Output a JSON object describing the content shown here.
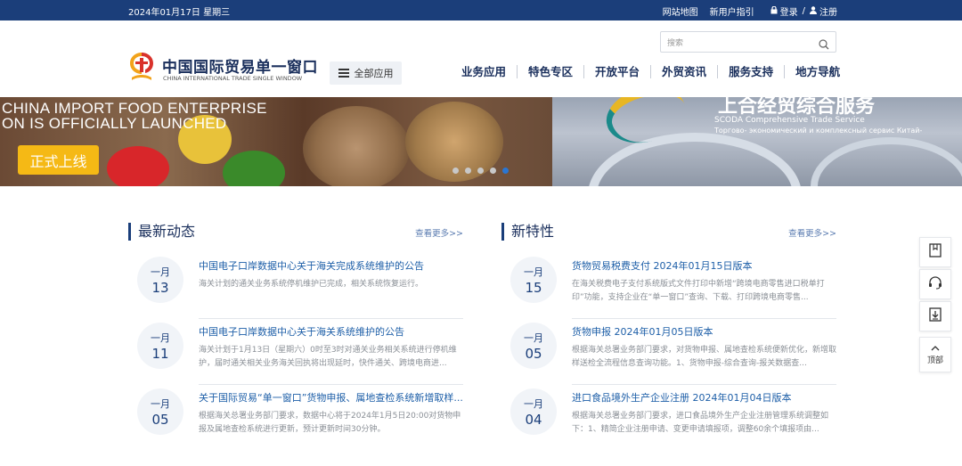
{
  "topbar": {
    "date": "2024年01月17日 星期三",
    "sitemap": "网站地图",
    "new_user_guide": "新用户指引",
    "login": "登录",
    "separator": "/",
    "register": "注册"
  },
  "header": {
    "logo_cn": "中国国际贸易单一窗口",
    "logo_en": "CHINA INTERNATIONAL TRADE SINGLE WINDOW",
    "all_apps": "全部应用",
    "search_placeholder": "搜索",
    "nav": [
      "业务应用",
      "特色专区",
      "开放平台",
      "外贸资讯",
      "服务支持",
      "地方导航"
    ]
  },
  "banner": {
    "left_line1": "CHINA IMPORT FOOD ENTERPRISE",
    "left_line2": "ON IS OFFICIALLY LAUNCHED",
    "launch_button": "正式上线",
    "right_cn": "上合经贸综合服务",
    "right_en1": "SCODA Comprehensive Trade Service",
    "right_en2": "Торгово- экономический и комплексный сервис Китай-",
    "active_slide": 5,
    "slide_count": 5
  },
  "news": {
    "title": "最新动态",
    "more": "查看更多>>",
    "items": [
      {
        "month": "一月",
        "day": "13",
        "title": "中国电子口岸数据中心关于海关完成系统维护的公告",
        "desc": "海关计划的通关业务系统停机维护已完成，相关系统恢复运行。"
      },
      {
        "month": "一月",
        "day": "11",
        "title": "中国电子口岸数据中心关于海关系统维护的公告",
        "desc": "海关计划于1月13日（星期六）0时至3时对通关业务相关系统进行停机维护，届时通关相关业务海关回执将出现延时，快件通关、跨境电商进..."
      },
      {
        "month": "一月",
        "day": "05",
        "title": "关于国际贸易“单一窗口”货物申报、属地查检系统新增取样...",
        "desc": "根据海关总署业务部门要求，数据中心将于2024年1月5日20:00对货物申报及属地查检系统进行更新，预计更新时间30分钟。"
      }
    ]
  },
  "features": {
    "title": "新特性",
    "more": "查看更多>>",
    "items": [
      {
        "month": "一月",
        "day": "15",
        "title": "货物贸易税费支付 2024年01月15日版本",
        "desc": "在海关税费电子支付系统版式文件打印中新增“跨境电商零售进口税单打印”功能，支持企业在“单一窗口”查询、下载、打印跨境电商零售..."
      },
      {
        "month": "一月",
        "day": "05",
        "title": "货物申报 2024年01月05日版本",
        "desc": "根据海关总署业务部门要求，对货物申报、属地查检系统便新优化，新增取样送检全流程信息查询功能。1、货物申报-综合查询-报关数据查..."
      },
      {
        "month": "一月",
        "day": "04",
        "title": "进口食品境外生产企业注册 2024年01月04日版本",
        "desc": "根据海关总署业务部门要求，进口食品境外生产企业注册管理系统调整如下：1、精简企业注册申请、变更申请填报项，调整60余个填报项由..."
      }
    ]
  },
  "float_toolbar": {
    "top_label": "顶部"
  },
  "colors": {
    "topbar_bg": "#1b3e7a",
    "accent": "#1e5fa8",
    "launch_button": "#f5b915",
    "active_dot": "#2a76d2"
  }
}
